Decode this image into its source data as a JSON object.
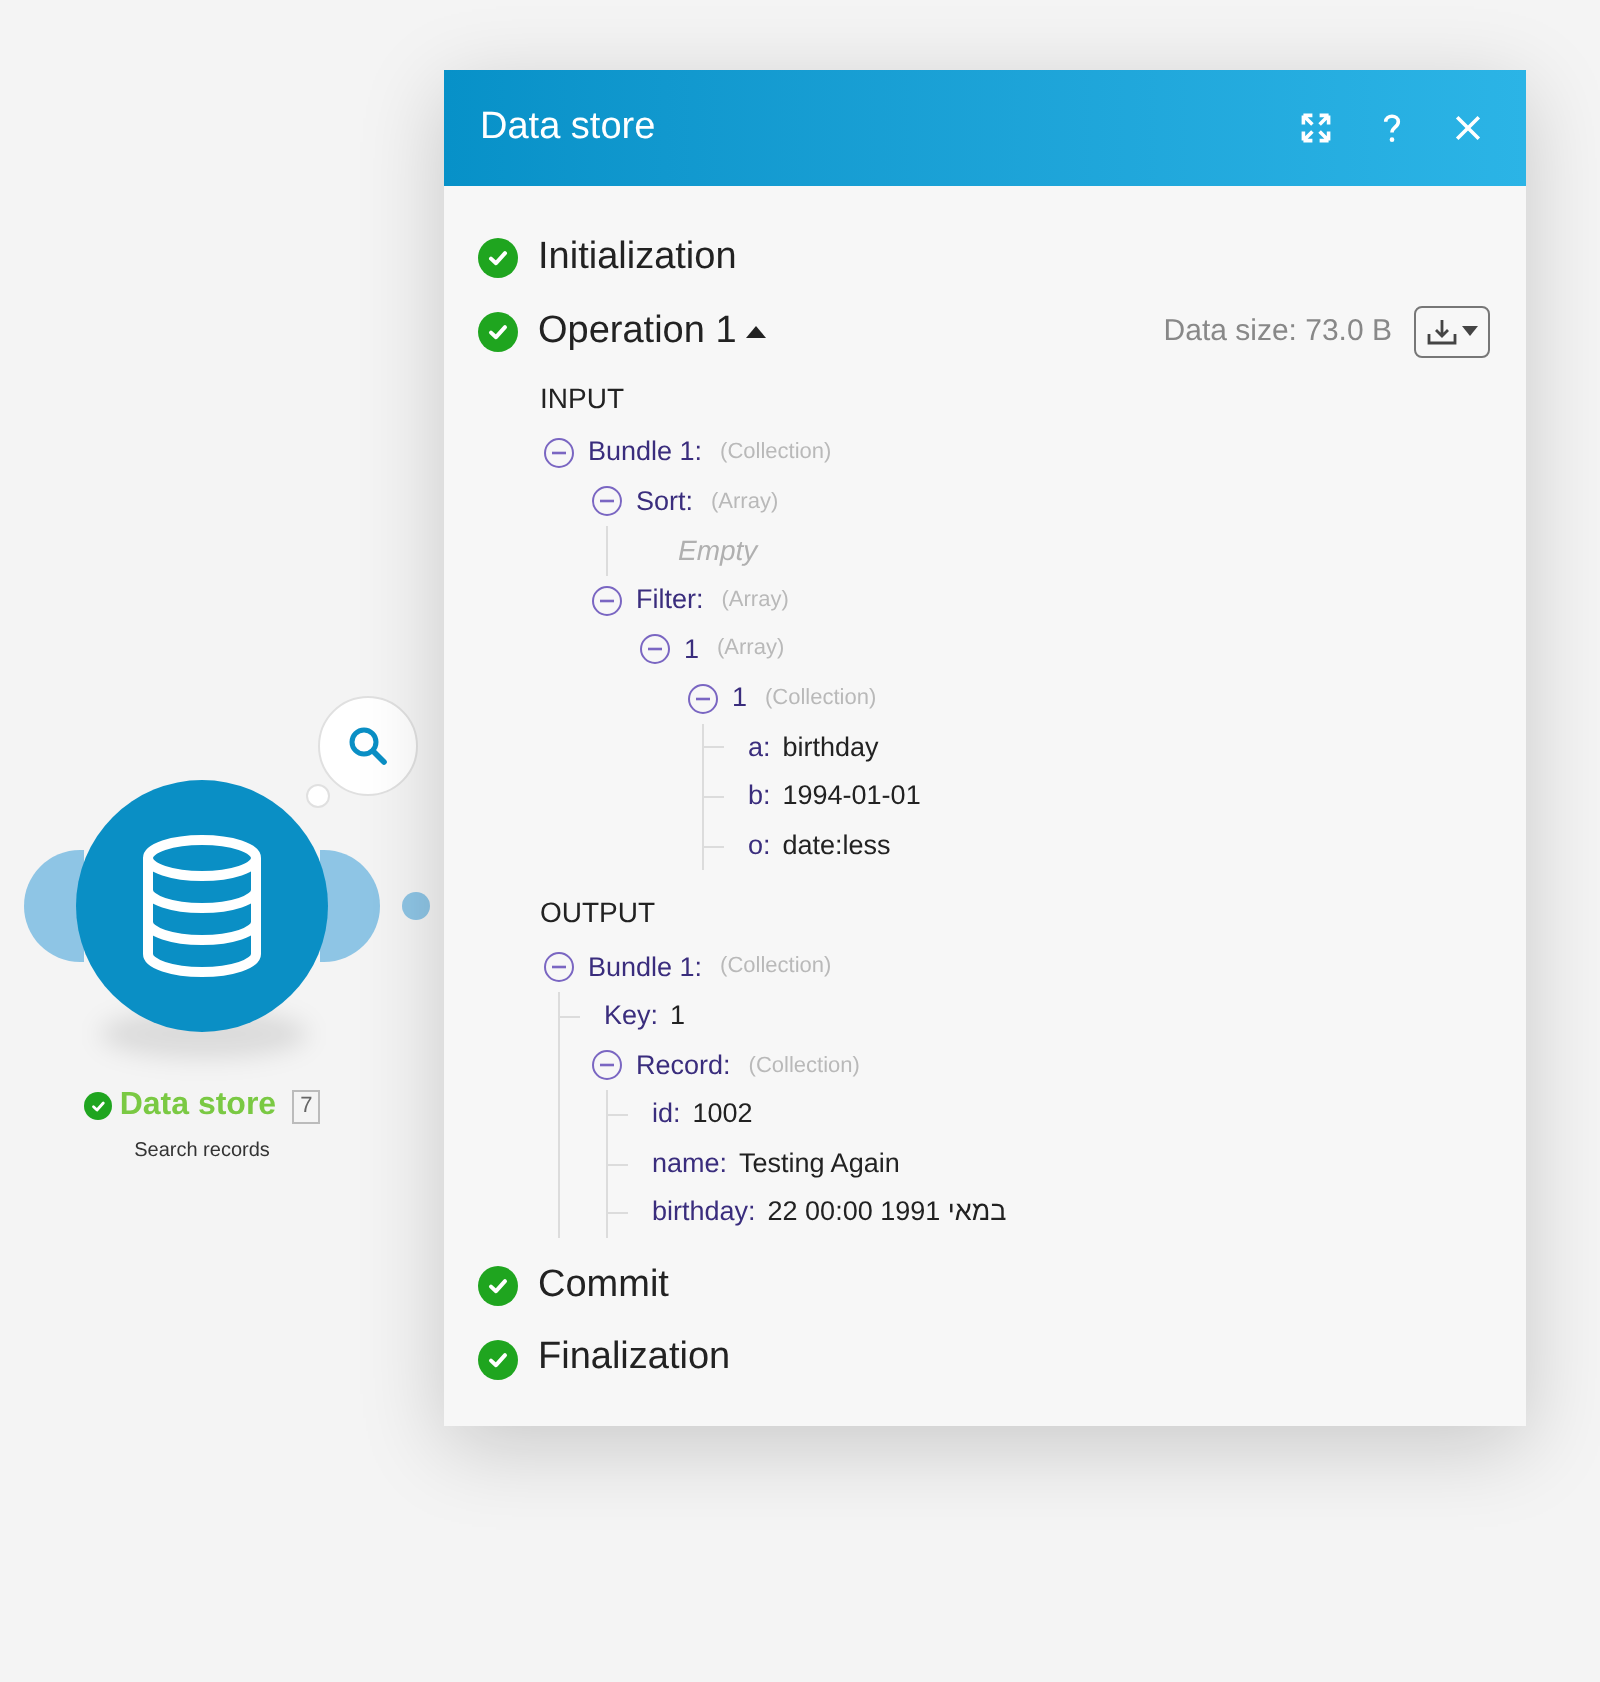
{
  "node": {
    "title": "Data store",
    "badge": "7",
    "subtitle": "Search records",
    "done": true
  },
  "panel": {
    "title": "Data store",
    "steps": [
      {
        "label": "Initialization",
        "done": true
      },
      {
        "label": "Operation 1",
        "done": true,
        "expanded": true,
        "data_size": "Data size: 73.0 B",
        "sections": [
          {
            "heading": "INPUT",
            "tree": [
              {
                "kind": "collection",
                "key": "Bundle 1:",
                "type": "(Collection)",
                "expanded": true,
                "children": [
                  {
                    "kind": "collection",
                    "key": "Sort:",
                    "type": "(Array)",
                    "expanded": true,
                    "children": [
                      {
                        "kind": "empty",
                        "text": "Empty"
                      }
                    ]
                  },
                  {
                    "kind": "collection",
                    "key": "Filter:",
                    "type": "(Array)",
                    "expanded": true,
                    "children": [
                      {
                        "kind": "collection",
                        "key": "1",
                        "type": "(Array)",
                        "expanded": true,
                        "children": [
                          {
                            "kind": "collection",
                            "key": "1",
                            "type": "(Collection)",
                            "expanded": true,
                            "children": [
                              {
                                "kind": "value",
                                "key": "a:",
                                "value": "birthday"
                              },
                              {
                                "kind": "value",
                                "key": "b:",
                                "value": "1994-01-01"
                              },
                              {
                                "kind": "value",
                                "key": "o:",
                                "value": "date:less"
                              }
                            ]
                          }
                        ]
                      }
                    ]
                  }
                ]
              }
            ]
          },
          {
            "heading": "OUTPUT",
            "tree": [
              {
                "kind": "collection",
                "key": "Bundle 1:",
                "type": "(Collection)",
                "expanded": true,
                "children": [
                  {
                    "kind": "value",
                    "key": "Key:",
                    "value": "1"
                  },
                  {
                    "kind": "collection",
                    "key": "Record:",
                    "type": "(Collection)",
                    "expanded": true,
                    "children": [
                      {
                        "kind": "value",
                        "key": "id:",
                        "value": "1002"
                      },
                      {
                        "kind": "value",
                        "key": "name:",
                        "value": "Testing Again"
                      },
                      {
                        "kind": "value",
                        "key": "birthday:",
                        "value": "22 00:00 1991 במאי"
                      }
                    ]
                  }
                ]
              }
            ]
          }
        ]
      },
      {
        "label": "Commit",
        "done": true
      },
      {
        "label": "Finalization",
        "done": true
      }
    ]
  }
}
